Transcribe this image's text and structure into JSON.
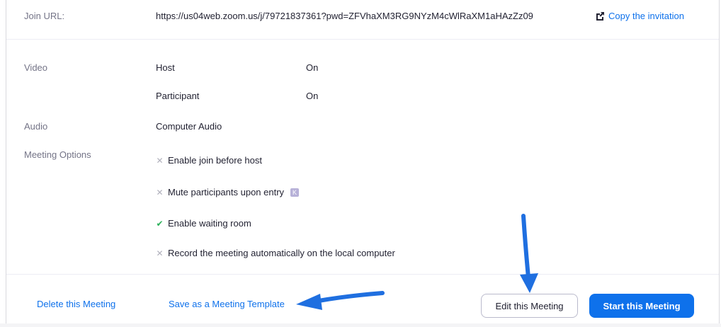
{
  "join": {
    "label": "Join URL:",
    "url": "https://us04web.zoom.us/j/79721837361?pwd=ZFVhaXM3RG9NYzM4cWlRaXM1aHAzZz09",
    "copy_label": "Copy the invitation"
  },
  "video": {
    "label": "Video",
    "host_label": "Host",
    "host_value": "On",
    "participant_label": "Participant",
    "participant_value": "On"
  },
  "audio": {
    "label": "Audio",
    "value": "Computer Audio"
  },
  "options": {
    "label": "Meeting Options",
    "items": [
      {
        "text": "Enable join before host",
        "enabled": false
      },
      {
        "text": "Mute participants upon entry",
        "enabled": false,
        "badge": "K"
      },
      {
        "text": "Enable waiting room",
        "enabled": true
      },
      {
        "text": "Record the meeting automatically on the local computer",
        "enabled": false
      }
    ]
  },
  "footer": {
    "delete_label": "Delete this Meeting",
    "template_label": "Save as a Meeting Template",
    "edit_label": "Edit this Meeting",
    "start_label": "Start this Meeting"
  },
  "colors": {
    "accent": "#0e71eb",
    "annotation_arrow": "#1f6fe0",
    "check": "#2cb15a"
  }
}
